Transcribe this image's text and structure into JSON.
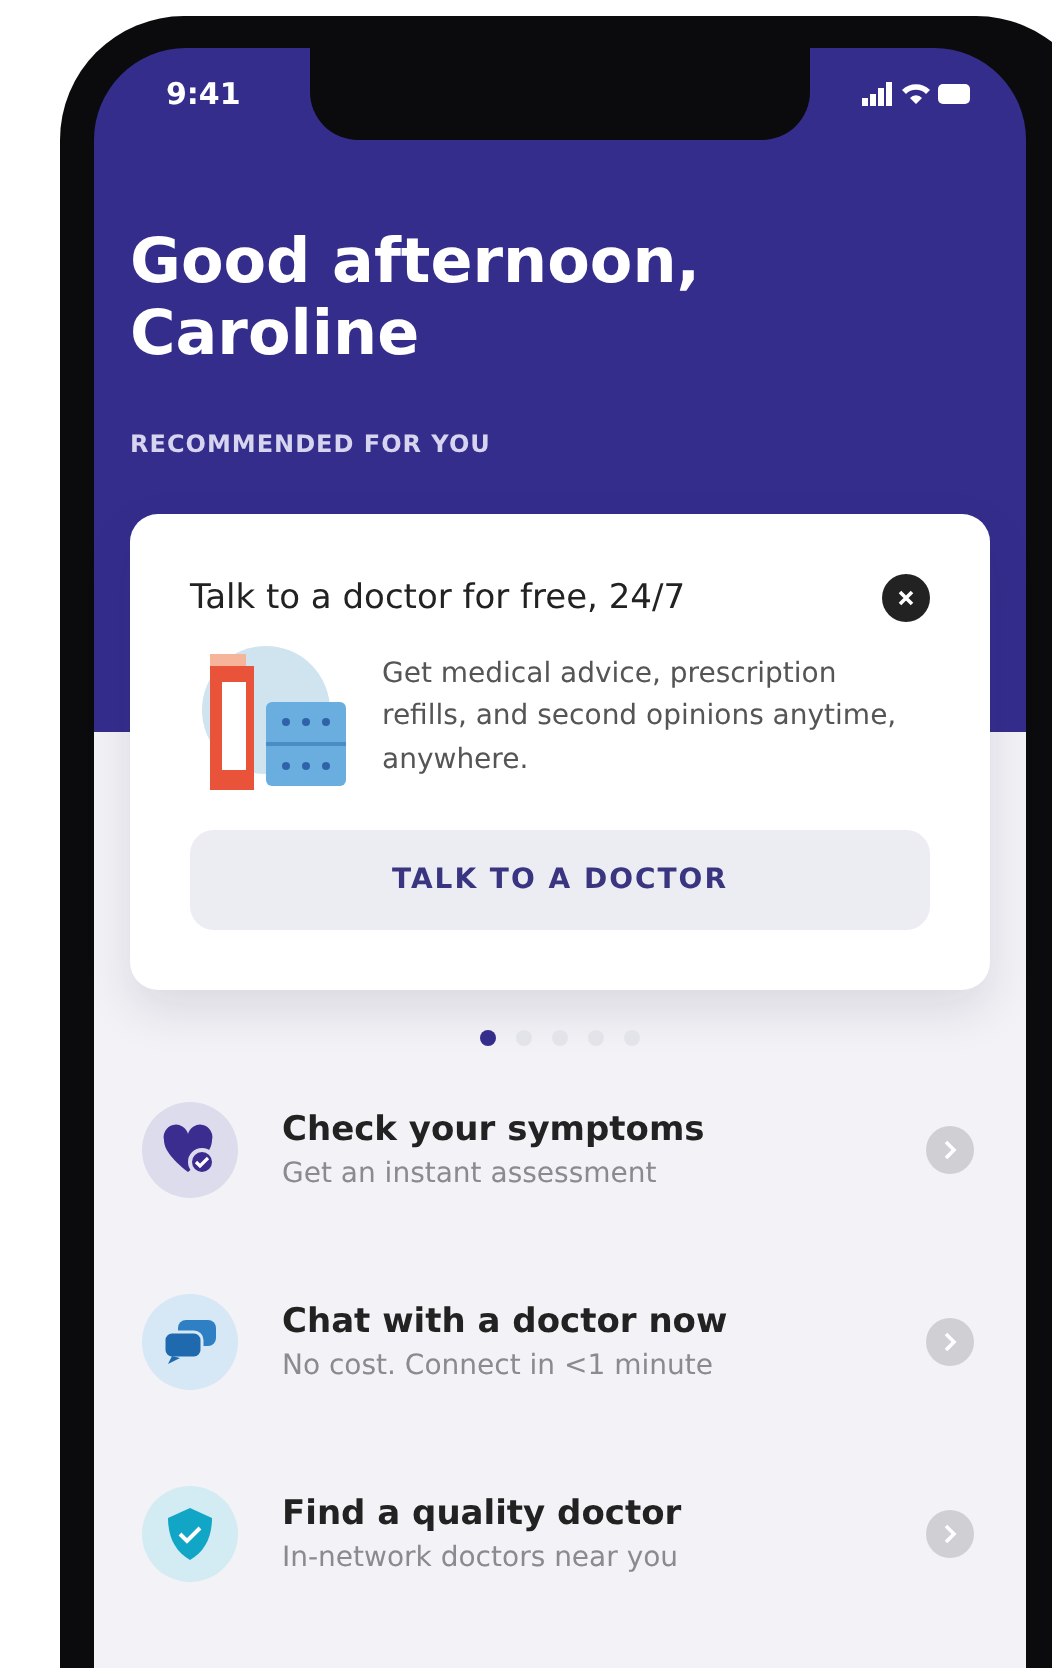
{
  "status_bar": {
    "time": "9:41"
  },
  "greeting": {
    "title": "Good afternoon, Caroline",
    "section_label": "RECOMMENDED FOR YOU"
  },
  "promo_card": {
    "title": "Talk to a doctor for free, 24/7",
    "body": "Get medical advice, prescription refills, and second opinions anytime, anywhere.",
    "button": "TALK TO A DOCTOR"
  },
  "carousel_dots": [
    {
      "selected": true
    },
    {
      "selected": false
    },
    {
      "selected": false
    },
    {
      "selected": false
    },
    {
      "selected": false
    }
  ],
  "actions": [
    {
      "kind": "heart",
      "title": "Check your symptoms",
      "subtitle": "Get an instant assessment"
    },
    {
      "kind": "chat",
      "title": "Chat with a doctor now",
      "subtitle": "No cost. Connect in <1 minute"
    },
    {
      "kind": "shield",
      "title": "Find a quality doctor",
      "subtitle": "In-network doctors near you"
    }
  ]
}
